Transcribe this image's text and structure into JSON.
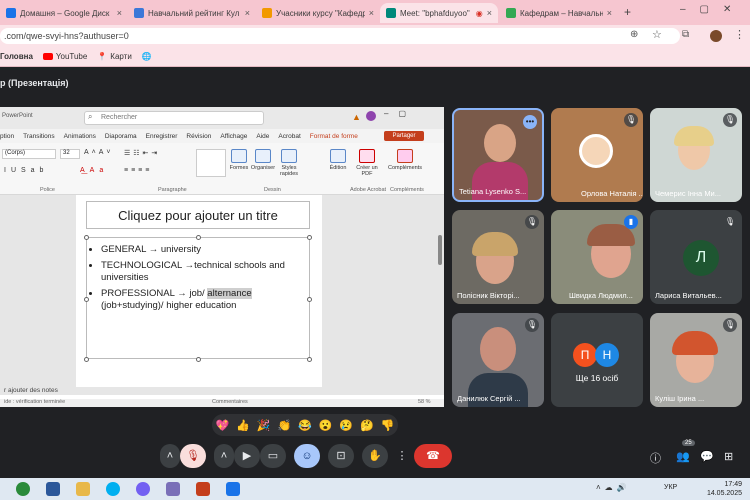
{
  "tabs": [
    {
      "title": "Домашня – Google Диск",
      "color": "#1a73e8"
    },
    {
      "title": "Навчальний рейтинг Кул",
      "color": "#3c78d8"
    },
    {
      "title": "Учасники курсу \"Кафедр",
      "color": "#f29900"
    },
    {
      "title": "Meet: \"bphafduyoo\"",
      "color": "#00897b"
    },
    {
      "title": "Кафедрам – Навчально-",
      "color": "#34a853"
    }
  ],
  "new_tab": "+",
  "url": ".com/qwe-svyi-hns?authuser=0",
  "bookmarks": [
    "Головна",
    "YouTube",
    "Карти"
  ],
  "meet_title": "р (Презентація)",
  "ppt": {
    "app": "PowerPoint",
    "search": "Rechercher",
    "share": "Partager",
    "tabs": [
      "ption",
      "Transitions",
      "Animations",
      "Diaporama",
      "Enregistrer",
      "Révision",
      "Affichage",
      "Aide",
      "Acrobat",
      "Format de forme"
    ],
    "font": "(Corps)",
    "size": "32",
    "groups": [
      "Police",
      "Paragraphe",
      "Dessin",
      "Adobe Acrobat",
      "Compléments"
    ],
    "buttons": [
      "Formes",
      "Organiser",
      "Styles rapides",
      "Édition",
      "Créer un PDF",
      "Compléments"
    ],
    "slide_title": "Cliquez pour ajouter un titre",
    "bullets": [
      {
        "a": "GENERAL → university",
        "b": "",
        "c": ""
      },
      {
        "a": "TECHNOLOGICAL →technical schools and universities",
        "b": "",
        "c": ""
      },
      {
        "a": "PROFESSIONAL → job/ ",
        "b": "alternance",
        "c": " (job+studying)/ higher education"
      }
    ],
    "notes": "r ajouter des notes",
    "comments": "Commentaires",
    "zoom": "58 %",
    "status": "ide : vérification terminée"
  },
  "participants": [
    {
      "name": "Tetiana Lysenko S...",
      "bg": "#7a5a4a"
    },
    {
      "name": "Орлова Наталія ...",
      "bg": "#b07b4f"
    },
    {
      "name": "Чемерис Інна Ми...",
      "bg": "#cfd7d4"
    },
    {
      "name": "Полісник Вікторі...",
      "bg": "#6d6a63"
    },
    {
      "name": "Швидка Людмил...",
      "bg": "#8a8c7a"
    },
    {
      "name": "Лариса Витальев...",
      "bg": "#3c4043"
    },
    {
      "name": "Данилюк Сергій ...",
      "bg": "#6b6d72"
    },
    {
      "name": "Ще 16 осіб",
      "bg": "#3c4043"
    },
    {
      "name": "Куліш Ірина ...",
      "bg": "#a8a9a5"
    }
  ],
  "avatar_letter": "Л",
  "more_p": "П",
  "more_n": "Н",
  "people_count": "25",
  "reactions": [
    "💖",
    "👍",
    "🎉",
    "👏",
    "😂",
    "😮",
    "😢",
    "🤔",
    "👎"
  ],
  "time": "17:49",
  "date": "14.05.2025",
  "lang": "УКР"
}
